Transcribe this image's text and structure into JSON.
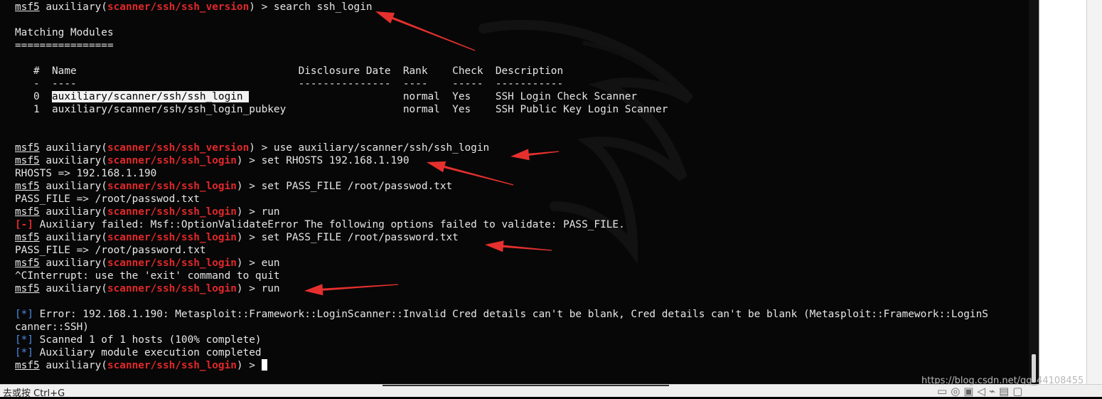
{
  "colors": {
    "background": "#070707",
    "text": "#e6e6e6",
    "module_path": "#e0282a",
    "status_marker": "#4f8ae6",
    "annotation_arrow": "#e6302e"
  },
  "terminal": {
    "search": {
      "prompt": "msf5",
      "module_prefix": " auxiliary(",
      "module": "scanner/ssh/ssh_version",
      "module_suffix": ") > ",
      "command": "search ssh_login"
    },
    "matching_heading": "Matching Modules",
    "matching_rule": "================",
    "table": {
      "headers": {
        "num": "#",
        "name": "Name",
        "disclosure_date": "Disclosure Date",
        "rank": "Rank",
        "check": "Check",
        "description": "Description"
      },
      "separators": {
        "num": "-",
        "name": "----",
        "disclosure_date": "---------------",
        "rank": "----",
        "check": "-----",
        "description": "-----------"
      },
      "rows": [
        {
          "num": "0",
          "name": "auxiliary/scanner/ssh/ssh_login",
          "disclosure_date": "",
          "rank": "normal",
          "check": "Yes",
          "description": "SSH Login Check Scanner"
        },
        {
          "num": "1",
          "name": "auxiliary/scanner/ssh/ssh_login_pubkey",
          "disclosure_date": "",
          "rank": "normal",
          "check": "Yes",
          "description": "SSH Public Key Login Scanner"
        }
      ]
    },
    "session": [
      {
        "kind": "prompt",
        "prompt": "msf5",
        "module_prefix": " auxiliary(",
        "module": "scanner/ssh/ssh_version",
        "module_suffix": ") > ",
        "command": "use auxiliary/scanner/ssh/ssh_login"
      },
      {
        "kind": "prompt",
        "prompt": "msf5",
        "module_prefix": " auxiliary(",
        "module": "scanner/ssh/ssh_login",
        "module_suffix": ") > ",
        "command": "set RHOSTS 192.168.1.190"
      },
      {
        "kind": "output",
        "text": "RHOSTS => 192.168.1.190"
      },
      {
        "kind": "prompt",
        "prompt": "msf5",
        "module_prefix": " auxiliary(",
        "module": "scanner/ssh/ssh_login",
        "module_suffix": ") > ",
        "command": "set PASS_FILE /root/passwod.txt"
      },
      {
        "kind": "output",
        "text": "PASS_FILE => /root/passwod.txt"
      },
      {
        "kind": "prompt",
        "prompt": "msf5",
        "module_prefix": " auxiliary(",
        "module": "scanner/ssh/ssh_login",
        "module_suffix": ") > ",
        "command": "run"
      },
      {
        "kind": "status",
        "marker": "[-]",
        "marker_color": "red",
        "text": " Auxiliary failed: Msf::OptionValidateError The following options failed to validate: PASS_FILE."
      },
      {
        "kind": "prompt",
        "prompt": "msf5",
        "module_prefix": " auxiliary(",
        "module": "scanner/ssh/ssh_login",
        "module_suffix": ") > ",
        "command": "set PASS_FILE /root/password.txt"
      },
      {
        "kind": "output",
        "text": "PASS_FILE => /root/password.txt"
      },
      {
        "kind": "prompt",
        "prompt": "msf5",
        "module_prefix": " auxiliary(",
        "module": "scanner/ssh/ssh_login",
        "module_suffix": ") > ",
        "command": "eun"
      },
      {
        "kind": "output",
        "text": "^CInterrupt: use the 'exit' command to quit"
      },
      {
        "kind": "prompt",
        "prompt": "msf5",
        "module_prefix": " auxiliary(",
        "module": "scanner/ssh/ssh_login",
        "module_suffix": ") > ",
        "command": "run"
      },
      {
        "kind": "blank"
      },
      {
        "kind": "status",
        "marker": "[*]",
        "marker_color": "blue",
        "text": " Error: 192.168.1.190: Metasploit::Framework::LoginScanner::Invalid Cred details can't be blank, Cred details can't be blank (Metasploit::Framework::LoginS"
      },
      {
        "kind": "output",
        "text": "canner::SSH)"
      },
      {
        "kind": "status",
        "marker": "[*]",
        "marker_color": "blue",
        "text": " Scanned 1 of 1 hosts (100% complete)"
      },
      {
        "kind": "status",
        "marker": "[*]",
        "marker_color": "blue",
        "text": " Auxiliary module execution completed"
      },
      {
        "kind": "prompt",
        "prompt": "msf5",
        "module_prefix": " auxiliary(",
        "module": "scanner/ssh/ssh_login",
        "module_suffix": ") > ",
        "command": "",
        "cursor": true
      }
    ]
  },
  "statusbar": {
    "text": "去或按 Ctrl+G",
    "icons": [
      "window-icon",
      "globe-icon",
      "display-icon",
      "speaker-icon",
      "usb-icon",
      "printer-icon",
      "monitor-icon"
    ]
  },
  "watermark": "https://blog.csdn.net/qq_44108455"
}
